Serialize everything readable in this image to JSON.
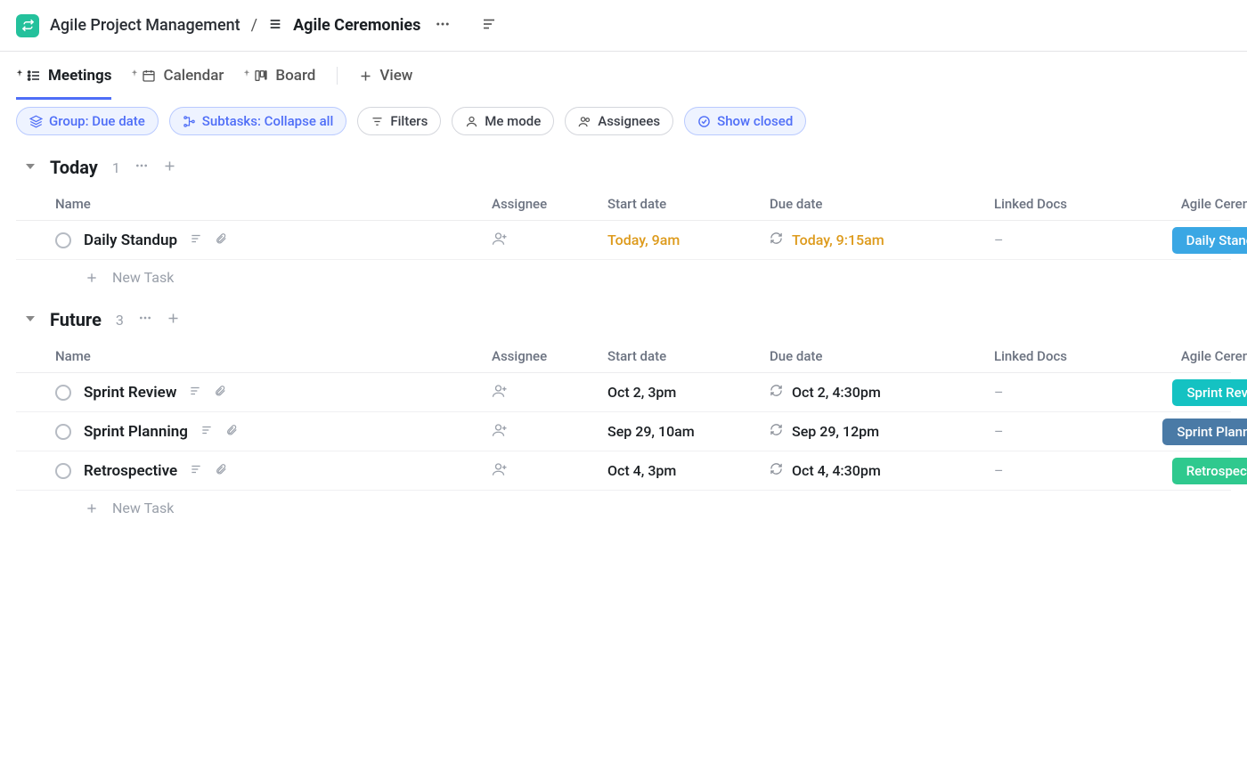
{
  "breadcrumb": {
    "workspace": "Agile Project Management",
    "separator": "/",
    "list": "Agile Ceremonies"
  },
  "views": {
    "v0": "Meetings",
    "v1": "Calendar",
    "v2": "Board",
    "add": "View"
  },
  "pills": {
    "group": "Group: Due date",
    "subtasks": "Subtasks: Collapse all",
    "filters": "Filters",
    "me": "Me mode",
    "assignees": "Assignees",
    "show_closed": "Show closed"
  },
  "columns": {
    "name": "Name",
    "assignee": "Assignee",
    "start": "Start date",
    "due": "Due date",
    "linked": "Linked Docs",
    "ceremony": "Agile Ceremony"
  },
  "groups": {
    "today": {
      "title": "Today",
      "count": "1"
    },
    "future": {
      "title": "Future",
      "count": "3"
    }
  },
  "tasks": {
    "t0": {
      "name": "Daily Standup",
      "start": "Today, 9am",
      "due": "Today, 9:15am",
      "linked": "–",
      "badge": "Daily Standup"
    },
    "t1": {
      "name": "Sprint Review",
      "start": "Oct 2, 3pm",
      "due": "Oct 2, 4:30pm",
      "linked": "–",
      "badge": "Sprint Review"
    },
    "t2": {
      "name": "Sprint Planning",
      "start": "Sep 29, 10am",
      "due": "Sep 29, 12pm",
      "linked": "–",
      "badge": "Sprint Planning"
    },
    "t3": {
      "name": "Retrospective",
      "start": "Oct 4, 3pm",
      "due": "Oct 4, 4:30pm",
      "linked": "–",
      "badge": "Retrospective"
    }
  },
  "new_task": "New Task"
}
